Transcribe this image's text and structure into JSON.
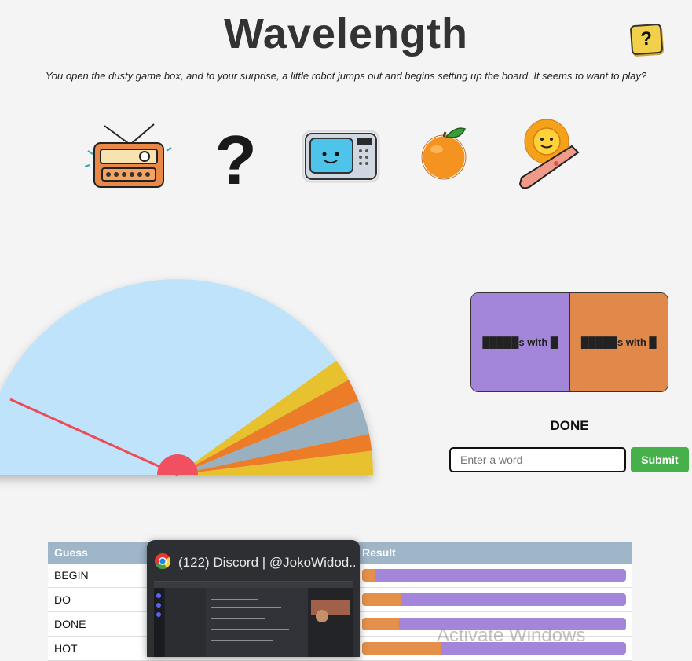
{
  "header": {
    "title": "Wavelength",
    "help_label": "?"
  },
  "intro": "You open the dusty game box, and to your surprise, a little robot jumps out and begins setting up the board. It seems to want to play?",
  "icons": [
    "radio-icon",
    "question-mark-icon",
    "microwave-icon",
    "orange-icon",
    "sun-arm-icon"
  ],
  "cards": {
    "left": "█████s with █",
    "right": "█████s with █"
  },
  "status": "DONE",
  "input": {
    "placeholder": "Enter a word",
    "value": ""
  },
  "submit_label": "Submit",
  "table": {
    "headers": [
      "Guess",
      "Result"
    ],
    "rows": [
      {
        "guess": "BEGIN",
        "result": 0.05
      },
      {
        "guess": "DO",
        "result": 0.15
      },
      {
        "guess": "DONE",
        "result": 0.14
      },
      {
        "guess": "HOT",
        "result": 0.3
      }
    ]
  },
  "popup": {
    "title": "(122) Discord | @JokoWidod..."
  },
  "watermark": "Activate Windows",
  "colors": {
    "meter_bg": "#bfe3fb",
    "band_yellow": "#e8c22e",
    "band_orange": "#ec7c28",
    "band_gray": "#98b0c0",
    "needle": "#f25060",
    "card_left": "#a385d9",
    "card_right": "#e0894a",
    "submit": "#46b04a"
  }
}
